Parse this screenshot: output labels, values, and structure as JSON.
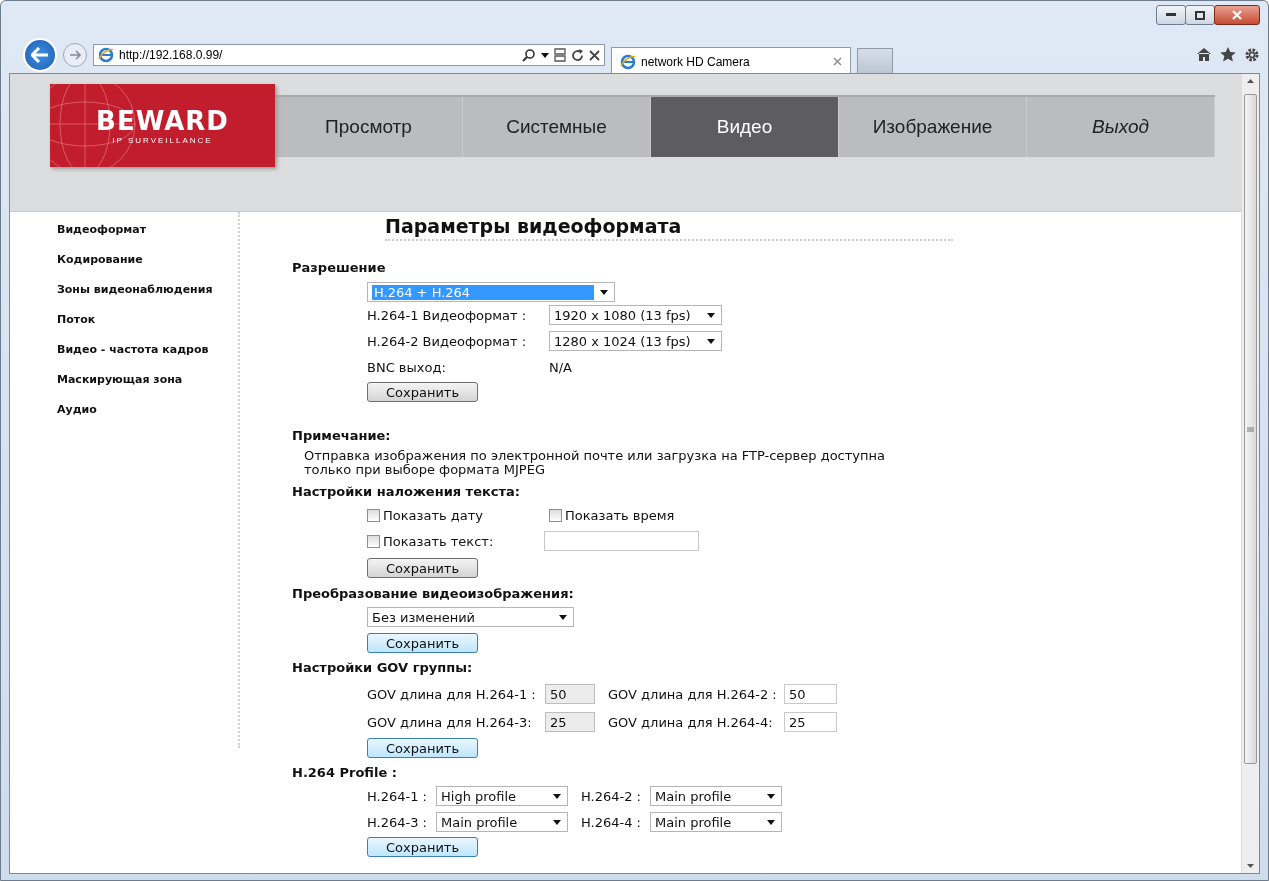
{
  "browser": {
    "url": "http://192.168.0.99/",
    "tab_title": "network HD Camera"
  },
  "logo": {
    "name": "BEWARD",
    "tagline": "IP SURVEILLANCE"
  },
  "nav": [
    {
      "label": "Просмотр",
      "selected": false
    },
    {
      "label": "Системные",
      "selected": false
    },
    {
      "label": "Видео",
      "selected": true
    },
    {
      "label": "Изображение",
      "selected": false
    },
    {
      "label": "Выход",
      "selected": false
    }
  ],
  "sidebar": [
    {
      "label": "Видеоформат"
    },
    {
      "label": "Кодирование"
    },
    {
      "label": "Зоны видеонаблюдения"
    },
    {
      "label": "Поток"
    },
    {
      "label": "Видео - частота кадров"
    },
    {
      "label": "Маскирующая зона"
    },
    {
      "label": "Аудио"
    }
  ],
  "page_title": "Параметры видеоформата",
  "resolution": {
    "heading": "Разрешение",
    "mode": "H.264 + H.264",
    "formats": [
      {
        "label": "H.264-1 Видеоформат :",
        "value": "1920 x 1080 (13 fps)"
      },
      {
        "label": "H.264-2 Видеоформат :",
        "value": "1280 x 1024 (13 fps)"
      }
    ],
    "bnc": {
      "label": "BNC выход:",
      "value": "N/A"
    },
    "save": "Сохранить"
  },
  "note": {
    "heading": "Примечание:",
    "text": "Отправка изображения по электронной почте или загрузка на FTP-сервер доступна только при выборе формата MJPEG"
  },
  "overlay": {
    "heading": "Настройки наложения текста:",
    "checkboxes": [
      {
        "label": "Показать дату",
        "checked": false
      },
      {
        "label": "Показать время",
        "checked": false
      },
      {
        "label": "Показать текст:",
        "checked": false
      }
    ],
    "save": "Сохранить"
  },
  "transform": {
    "heading": "Преобразование видеоизображения:",
    "value": "Без изменений",
    "save": "Сохранить"
  },
  "gov": {
    "heading": "Настройки GOV группы:",
    "fields": [
      {
        "label": "GOV длина для H.264-1 :",
        "value": "50",
        "disabled": true
      },
      {
        "label": "GOV длина для H.264-2 :",
        "value": "50",
        "disabled": false
      },
      {
        "label": "GOV длина для H.264-3:",
        "value": "25",
        "disabled": true
      },
      {
        "label": "GOV длина для H.264-4:",
        "value": "25",
        "disabled": false
      }
    ],
    "save": "Сохранить"
  },
  "profile": {
    "heading": "H.264 Profile :",
    "selects": [
      {
        "label": "H.264-1 :",
        "value": "High profile"
      },
      {
        "label": "H.264-2 :",
        "value": "Main profile"
      },
      {
        "label": "H.264-3 :",
        "value": "Main profile"
      },
      {
        "label": "H.264-4 :",
        "value": "Main profile"
      }
    ],
    "save": "Сохранить"
  }
}
